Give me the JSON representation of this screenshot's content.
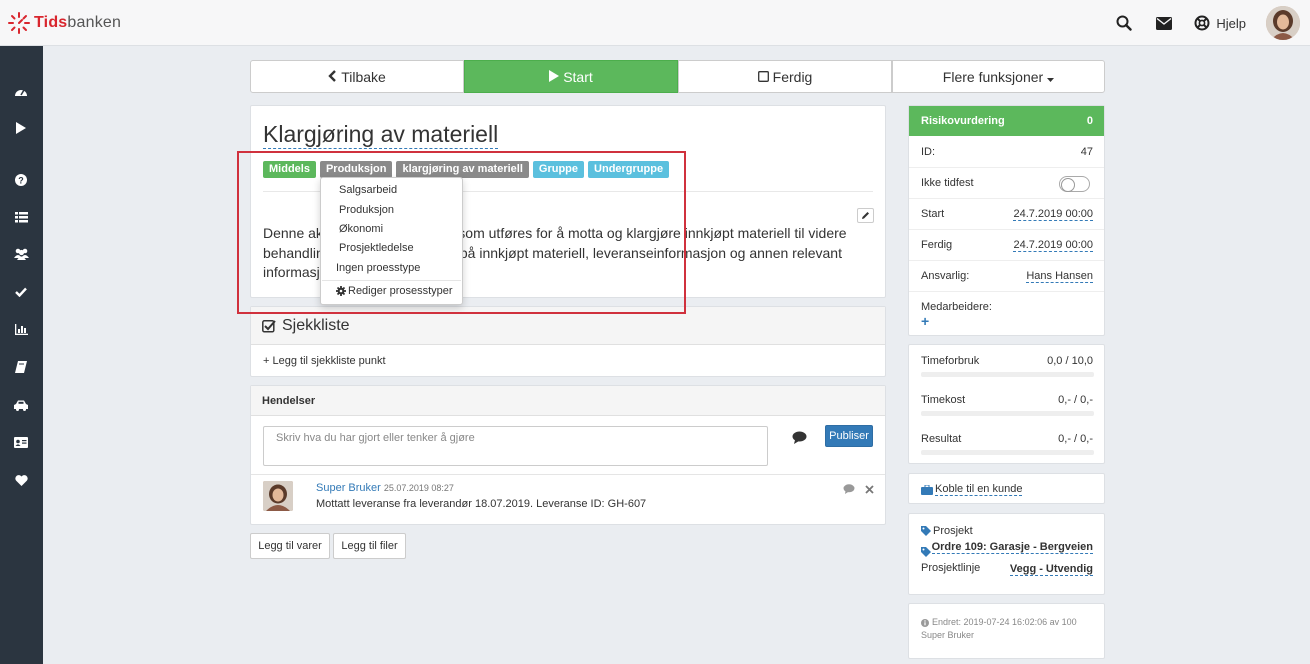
{
  "app": {
    "logo_prefix": "Tids",
    "logo_suffix": "banken",
    "help_label": "Hjelp"
  },
  "actions": {
    "back": "Tilbake",
    "start": "Start",
    "done": "Ferdig",
    "more": "Flere funksjoner"
  },
  "task": {
    "title": "Klargjøring av materiell",
    "labels": {
      "priority": "Middels",
      "process": "Produksjon",
      "type": "klargjøring av materiell",
      "group": "Gruppe",
      "subgroup": "Undergruppe"
    },
    "description_line1": "Denne akt                          beid som utføres for å motta og klargjøre innkjøpt materiell til videre",
    "description_line2": "behandlin                          ktura på innkjøpt materiell, leveranseinformasjon og annen relevant",
    "description_line3": "informasjo"
  },
  "process_dropdown": {
    "items": [
      "Salgsarbeid",
      "Produksjon",
      "Økonomi",
      "Prosjektledelse",
      "Ingen proesstype"
    ],
    "edit": "Rediger prosesstyper"
  },
  "checklist": {
    "title": "Sjekkliste",
    "add": "+ Legg til sjekkliste punkt"
  },
  "events": {
    "title": "Hendelser",
    "placeholder": "Skriv hva du har gjort eller tenker å gjøre",
    "publish": "Publiser",
    "entries": [
      {
        "author": "Super Bruker",
        "date": "25.07.2019 08:27",
        "text": "Mottatt leveranse fra leverandør 18.07.2019. Leveranse ID: GH-607"
      }
    ]
  },
  "bottom_buttons": {
    "add_items": "Legg til varer",
    "add_files": "Legg til filer"
  },
  "details": {
    "risk_label": "Risikovurdering",
    "risk_value": "0",
    "id_label": "ID:",
    "id_value": "47",
    "unscheduled_label": "Ikke tidfest",
    "start_label": "Start",
    "start_value": "24.7.2019 00:00",
    "end_label": "Ferdig",
    "end_value": "24.7.2019 00:00",
    "responsible_label": "Ansvarlig:",
    "responsible_value": "Hans Hansen",
    "coworkers_label": "Medarbeidere:",
    "add_coworker": "+"
  },
  "metrics": [
    {
      "label": "Timeforbruk",
      "value": "0,0 / 10,0",
      "fill_fraction": 0.0
    },
    {
      "label": "Timekost",
      "value": "0,- / 0,-",
      "fill_fraction": 0.0
    },
    {
      "label": "Resultat",
      "value": "0,- / 0,-",
      "fill_fraction": 0.0
    }
  ],
  "customer": {
    "link": "Koble til en kunde"
  },
  "project": {
    "project_label": "Prosjekt",
    "project_value": "Ordre 109: Garasje - Bergveien",
    "line_label": "Prosjektlinje",
    "line_value": "Vegg - Utvendig"
  },
  "footer": {
    "changed": "Endret: 2019-07-24 16:02:06 av 100",
    "by": "Super Bruker"
  },
  "colors": {
    "green": "#5cb85c",
    "blue": "#337ab7",
    "cyan": "#5bc0de",
    "grey": "#8a8a8a",
    "sidebar": "#2b3540",
    "highlight": "#d0313d"
  }
}
